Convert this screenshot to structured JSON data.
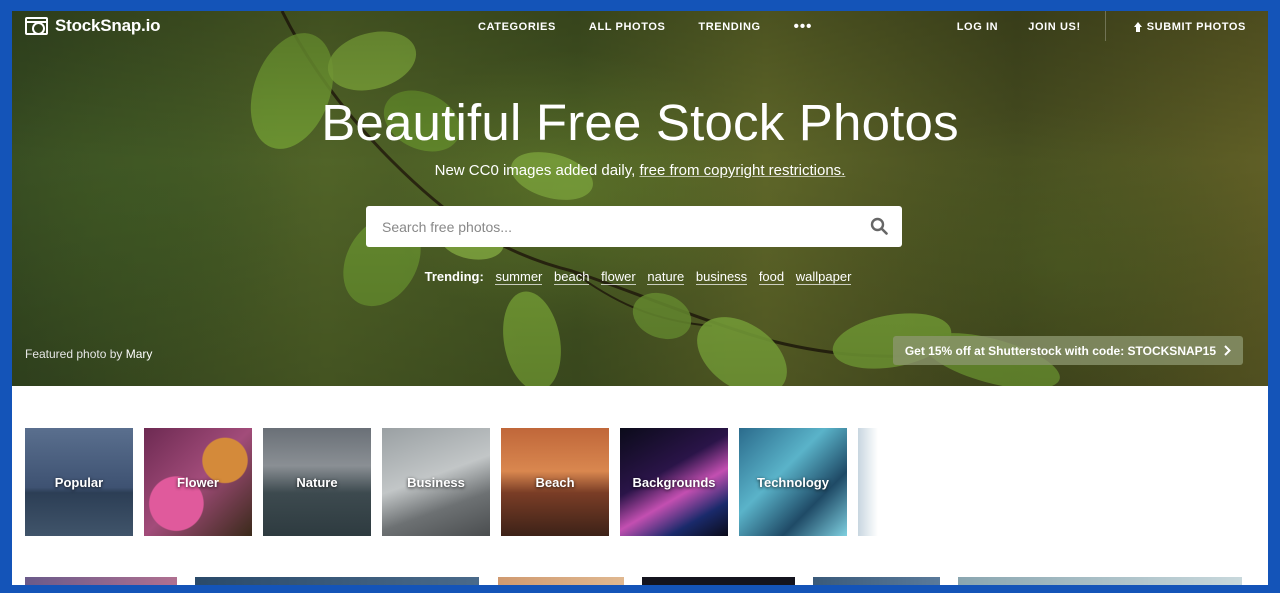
{
  "brand": {
    "name": "StockSnap.io"
  },
  "nav": {
    "categories": "CATEGORIES",
    "all_photos": "ALL PHOTOS",
    "trending": "TRENDING",
    "more": "•••",
    "login": "LOG IN",
    "join": "JOIN US!",
    "submit": "SUBMIT PHOTOS"
  },
  "hero": {
    "title": "Beautiful Free Stock Photos",
    "subtitle_prefix": "New CC0 images added daily, ",
    "subtitle_link": "free from copyright restrictions.",
    "search_placeholder": "Search free photos...",
    "trending_label": "Trending:",
    "trending_tags": [
      "summer",
      "beach",
      "flower",
      "nature",
      "business",
      "food",
      "wallpaper"
    ],
    "featured_prefix": "Featured photo by",
    "featured_author": "Mary",
    "promo": "Get 15% off at Shutterstock with code: STOCKSNAP15"
  },
  "categories": [
    "Popular",
    "Flower",
    "Nature",
    "Business",
    "Beach",
    "Backgrounds",
    "Technology"
  ],
  "icons": {
    "search": "search-icon",
    "upload": "upload-icon",
    "camera": "camera-logo-icon",
    "chevron": "chevron-right-icon"
  },
  "colors": {
    "frame": "#1454b8"
  }
}
